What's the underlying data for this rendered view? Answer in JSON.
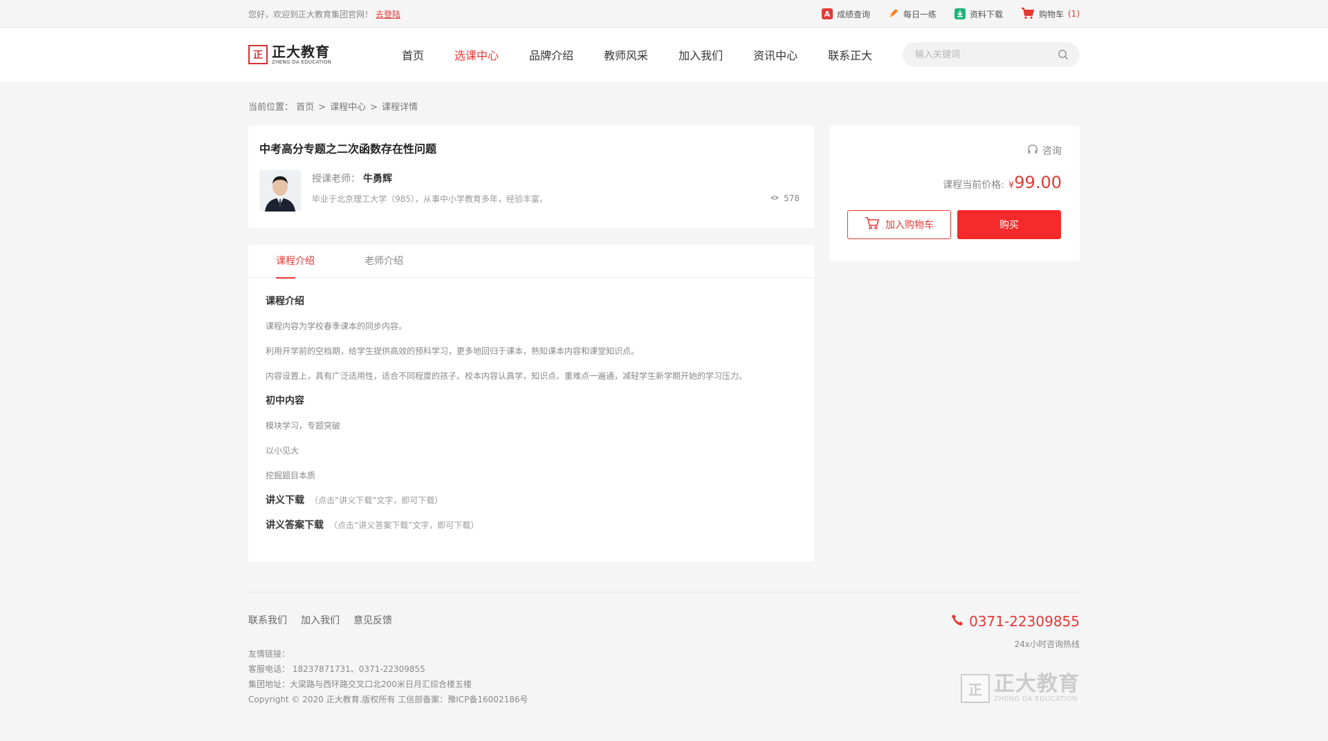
{
  "topbar": {
    "welcome": "您好，欢迎到正大教育集团官网！",
    "logout": "去登陆",
    "links": [
      {
        "label": "成绩查询",
        "icon": "score-icon",
        "color": "#e53935"
      },
      {
        "label": "每日一练",
        "icon": "pencil-icon",
        "color": "#ff7a1a"
      },
      {
        "label": "资料下载",
        "icon": "download-icon",
        "color": "#1fb37a"
      }
    ],
    "cart_label": "购物车",
    "cart_count": "(1)"
  },
  "header": {
    "logo_cn": "正大教育",
    "logo_en": "ZHENG DA EDUCATION",
    "nav": [
      "首页",
      "选课中心",
      "品牌介绍",
      "教师风采",
      "加入我们",
      "资讯中心",
      "联系正大"
    ],
    "active_nav": "选课中心",
    "search_placeholder": "输入关键词"
  },
  "breadcrumb": {
    "prefix": "当前位置：",
    "items": [
      "首页",
      "课程中心",
      "课程详情"
    ]
  },
  "course": {
    "title": "中考高分专题之二次函数存在性问题",
    "teacher_label": "授课老师：",
    "teacher_name": "牛勇辉",
    "teacher_desc": "毕业于北京理工大学（985），从事中小学教育多年，经验丰富。",
    "views": "578"
  },
  "tabs": [
    "课程介绍",
    "老师介绍"
  ],
  "content": {
    "h1": "课程介绍",
    "p1": "课程内容为学校春季课本的同步内容。",
    "p2": "利用开学前的空档期，给学生提供高效的预科学习，更多地回归于课本，熟知课本内容和课堂知识点。",
    "p3": "内容设置上，具有广泛适用性，适合不同程度的孩子。校本内容认真学，知识点、重难点一遍通，减轻学生新学期开始的学习压力。",
    "h2": "初中内容",
    "p4": "模块学习，专题突破",
    "p5": "以小见大",
    "p6": "挖掘题目本质",
    "dl1": "讲义下载",
    "dl1_hint": "（点击“讲义下载”文字，即可下载）",
    "dl2": "讲义答案下载",
    "dl2_hint": "（点击“讲义答案下载”文字，即可下载）"
  },
  "buy": {
    "consult": "咨询",
    "price_label": "课程当前价格:",
    "currency": "¥",
    "price": "99.00",
    "add_cart": "加入购物车",
    "buy_now": "购买"
  },
  "footer": {
    "links": [
      "联系我们",
      "加入我们",
      "意见反馈"
    ],
    "friend_links": "友情链接：",
    "service": "客服电话：  18237871731、0371-22309855",
    "address": "集团地址：大梁路与西环路交叉口北200米日月汇综合楼五楼",
    "copyright": "Copyright © 2020 正大教育.版权所有 工信部备案：豫ICP备16002186号",
    "hotline": "0371-22309855",
    "hotline_sub": "24x小时咨询热线",
    "logo_cn": "正大教育",
    "logo_en": "ZHENG DA EDUCATION"
  },
  "colors": {
    "accent": "#e53935",
    "buy_button": "#f52a2a"
  }
}
